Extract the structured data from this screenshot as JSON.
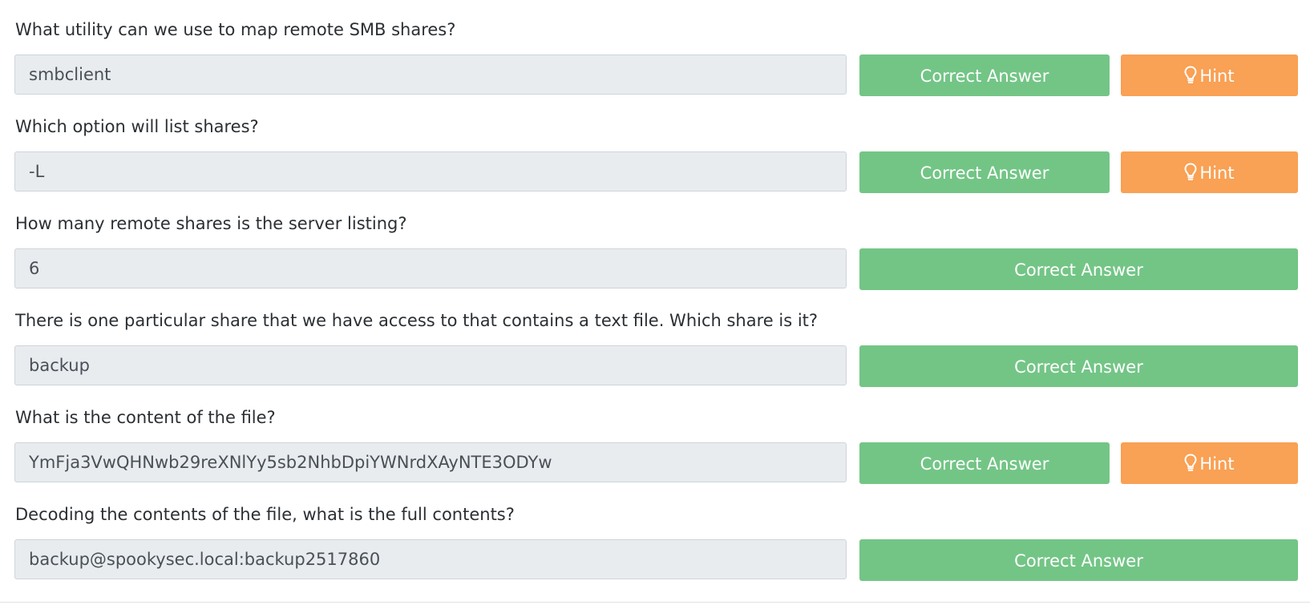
{
  "questions": [
    {
      "question": "What utility can we use to map remote SMB shares?",
      "answer": "smbclient",
      "correct_label": "Correct Answer",
      "hint_label": "Hint"
    },
    {
      "question": "Which option will list shares?",
      "answer": "-L",
      "correct_label": "Correct Answer",
      "hint_label": "Hint"
    },
    {
      "question": "How many remote shares is the server listing?",
      "answer": "6",
      "correct_label": "Correct Answer"
    },
    {
      "question": "There is one particular share that we have access to that contains a text file. Which share is it?",
      "answer": "backup",
      "correct_label": "Correct Answer"
    },
    {
      "question": "What is the content of the file?",
      "answer": "YmFja3VwQHNwb29reXNlYy5sb2NhbDpiYWNrdXAyNTE3ODYw",
      "correct_label": "Correct Answer",
      "hint_label": "Hint"
    },
    {
      "question": "Decoding the contents of the file, what is the full contents?",
      "answer": "backup@spookysec.local:backup2517860",
      "correct_label": "Correct Answer"
    }
  ],
  "icons": {
    "hint": "lightbulb-icon"
  },
  "colors": {
    "correct": "#73c586",
    "hint": "#f9a154",
    "field_bg": "#e9ecef"
  }
}
